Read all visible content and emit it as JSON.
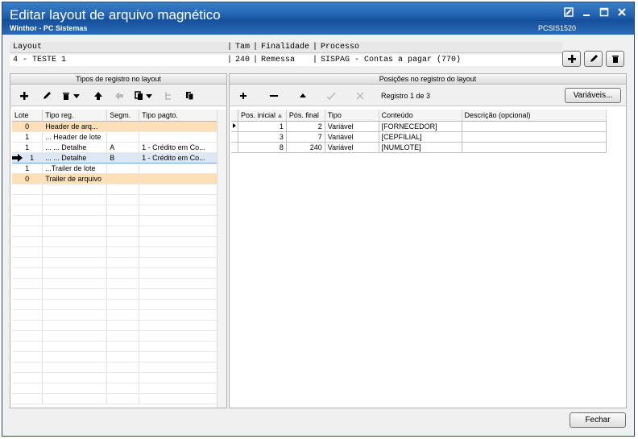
{
  "window": {
    "title": "Editar layout de arquivo magnético",
    "subtitle": "Winthor - PC Sistemas",
    "code": "PCSIS1520"
  },
  "layout": {
    "headers": [
      "Layout",
      "Tam",
      "Finalidade",
      "Processo"
    ],
    "value": "4 - TESTE 1",
    "tam": "240",
    "finalidade": "Remessa",
    "processo": "SISPAG - Contas a pagar (770)"
  },
  "left_panel": {
    "title": "Tipos de registro no layout",
    "columns": [
      "Lote",
      "Tipo reg.",
      "Segm.",
      "Tipo pagto."
    ],
    "rows": [
      {
        "lote": "0",
        "tipo": "Header de arq...",
        "segm": "",
        "pagto": ""
      },
      {
        "lote": "1",
        "tipo": "... Header de lote",
        "segm": "",
        "pagto": ""
      },
      {
        "lote": "1",
        "tipo": "... ... Detalhe",
        "segm": "A",
        "pagto": "1 - Crédito em Co..."
      },
      {
        "lote": "1",
        "tipo": "... ... Detalhe",
        "segm": "B",
        "pagto": "1 - Crédito em Co..."
      },
      {
        "lote": "1",
        "tipo": "...Trailer de lote",
        "segm": "",
        "pagto": ""
      },
      {
        "lote": "0",
        "tipo": "Trailer de arquivo",
        "segm": "",
        "pagto": ""
      }
    ]
  },
  "right_panel": {
    "title": "Posições no registro do layout",
    "record_counter": "Registro 1 de 3",
    "variables_button": "Variáveis...",
    "columns": [
      "Pos. inicial",
      "Pós. final",
      "Tipo",
      "Conteúdo",
      "Descrição (opcional)"
    ],
    "rows": [
      {
        "inicial": "1",
        "final": "2",
        "tipo": "Variável",
        "conteudo": "[FORNECEDOR]",
        "descricao": ""
      },
      {
        "inicial": "3",
        "final": "7",
        "tipo": "Variável",
        "conteudo": "[CEPFILIAL]",
        "descricao": ""
      },
      {
        "inicial": "8",
        "final": "240",
        "tipo": "Variável",
        "conteudo": "[NUMLOTE]",
        "descricao": ""
      }
    ]
  },
  "footer": {
    "close_button": "Fechar"
  }
}
